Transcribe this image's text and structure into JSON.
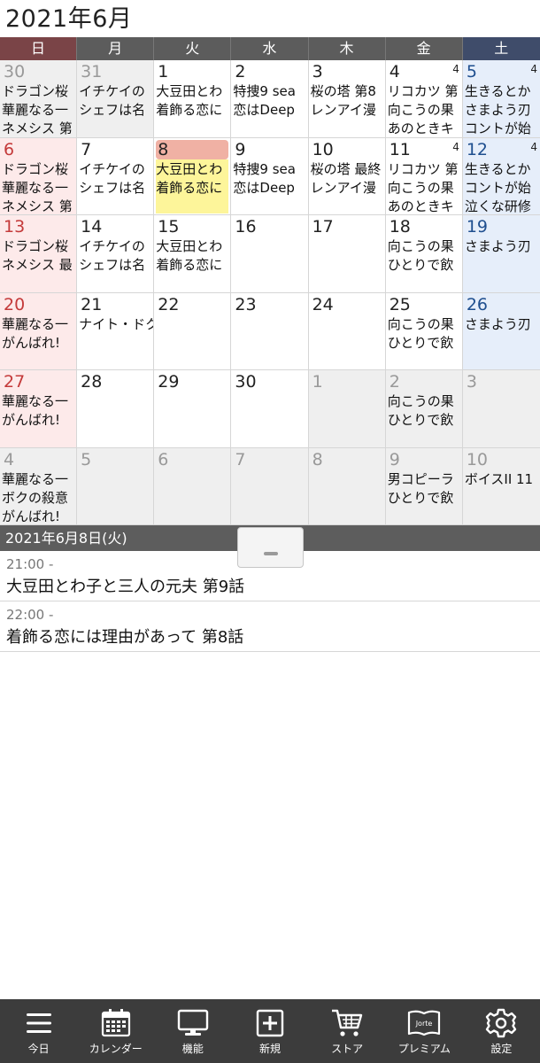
{
  "header": {
    "month_title": "2021年6月"
  },
  "weekdays": [
    "日",
    "月",
    "火",
    "水",
    "木",
    "金",
    "土"
  ],
  "weeks": [
    [
      {
        "day": "30",
        "events": [
          "ドラゴン桜",
          "華麗なる一",
          "ネメシス 第"
        ]
      },
      {
        "day": "31",
        "events": [
          "イチケイの",
          "シェフは名"
        ]
      },
      {
        "day": "1",
        "events": [
          "大豆田とわ",
          "着飾る恋に"
        ]
      },
      {
        "day": "2",
        "events": [
          "特捜9 sea",
          "恋はDeep"
        ]
      },
      {
        "day": "3",
        "events": [
          "桜の塔 第8",
          "レンアイ漫"
        ]
      },
      {
        "day": "4",
        "badge": "4",
        "events": [
          "リコカツ 第",
          "向こうの果",
          "あのときキ"
        ]
      },
      {
        "day": "5",
        "badge": "4",
        "events": [
          "生きるとか",
          "さまよう刃",
          "コントが始"
        ]
      }
    ],
    [
      {
        "day": "6",
        "events": [
          "ドラゴン桜",
          "華麗なる一",
          "ネメシス 第"
        ]
      },
      {
        "day": "7",
        "events": [
          "イチケイの",
          "シェフは名"
        ]
      },
      {
        "day": "8",
        "events": [
          "大豆田とわ",
          "着飾る恋に"
        ]
      },
      {
        "day": "9",
        "events": [
          "特捜9 sea",
          "恋はDeep"
        ]
      },
      {
        "day": "10",
        "events": [
          "桜の塔 最終",
          "レンアイ漫"
        ]
      },
      {
        "day": "11",
        "badge": "4",
        "events": [
          "リコカツ 第",
          "向こうの果",
          "あのときキ"
        ]
      },
      {
        "day": "12",
        "badge": "4",
        "events": [
          "生きるとか",
          "コントが始",
          "泣くな研修"
        ]
      }
    ],
    [
      {
        "day": "13",
        "events": [
          "ドラゴン桜",
          "ネメシス 最"
        ]
      },
      {
        "day": "14",
        "events": [
          "イチケイの",
          "シェフは名"
        ]
      },
      {
        "day": "15",
        "events": [
          "大豆田とわ",
          "着飾る恋に"
        ]
      },
      {
        "day": "16",
        "events": []
      },
      {
        "day": "17",
        "events": []
      },
      {
        "day": "18",
        "events": [
          "向こうの果",
          "ひとりで飲"
        ]
      },
      {
        "day": "19",
        "events": [
          "さまよう刃"
        ]
      }
    ],
    [
      {
        "day": "20",
        "events": [
          "華麗なる一",
          "がんばれ!"
        ]
      },
      {
        "day": "21",
        "events": [
          "ナイト・ドク"
        ]
      },
      {
        "day": "22",
        "events": []
      },
      {
        "day": "23",
        "events": []
      },
      {
        "day": "24",
        "events": []
      },
      {
        "day": "25",
        "events": [
          "向こうの果",
          "ひとりで飲"
        ]
      },
      {
        "day": "26",
        "events": [
          "さまよう刃"
        ]
      }
    ],
    [
      {
        "day": "27",
        "events": [
          "華麗なる一",
          "がんばれ!"
        ]
      },
      {
        "day": "28",
        "events": []
      },
      {
        "day": "29",
        "events": []
      },
      {
        "day": "30",
        "events": []
      },
      {
        "day": "1",
        "events": []
      },
      {
        "day": "2",
        "events": [
          "向こうの果",
          "ひとりで飲"
        ]
      },
      {
        "day": "3",
        "events": []
      }
    ],
    [
      {
        "day": "4",
        "events": [
          "華麗なる一",
          "ボクの殺意",
          "がんばれ!"
        ]
      },
      {
        "day": "5",
        "events": []
      },
      {
        "day": "6",
        "events": []
      },
      {
        "day": "7",
        "events": []
      },
      {
        "day": "8",
        "events": []
      },
      {
        "day": "9",
        "events": [
          "男コピーラ",
          "ひとりで飲"
        ]
      },
      {
        "day": "10",
        "events": [
          "ボイスII 11"
        ]
      }
    ]
  ],
  "detail": {
    "date_label": "2021年6月8日(火)",
    "events": [
      {
        "time": "21:00 -",
        "title": "大豆田とわ子と三人の元夫 第9話"
      },
      {
        "time": "22:00 -",
        "title": "着飾る恋には理由があって 第8話"
      }
    ]
  },
  "nav": [
    {
      "label": "今日",
      "icon": "menu-icon"
    },
    {
      "label": "カレンダー",
      "icon": "calendar-icon"
    },
    {
      "label": "機能",
      "icon": "monitor-icon"
    },
    {
      "label": "新規",
      "icon": "add-icon"
    },
    {
      "label": "ストア",
      "icon": "cart-icon"
    },
    {
      "label": "プレミアム",
      "icon": "jorte-book-icon"
    },
    {
      "label": "設定",
      "icon": "gear-icon"
    }
  ],
  "colors": {
    "sunday_header": "#7a4447",
    "saturday_header": "#3f4c6a",
    "today_marker": "#f0b1a4",
    "today_highlight": "#fdf59a",
    "nav_bg": "#3c3c3c"
  }
}
